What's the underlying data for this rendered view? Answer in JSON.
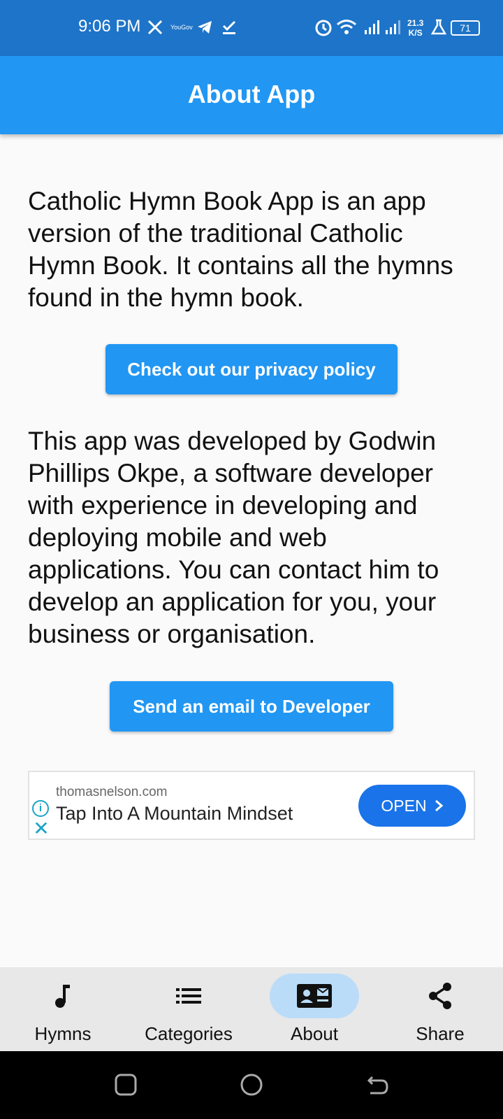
{
  "status_bar": {
    "time": "9:06 PM",
    "network_speed": "21.3",
    "network_unit": "K/S",
    "battery": "71",
    "notification_icons": [
      "x-icon",
      "yougov-icon",
      "telegram-icon",
      "check-icon"
    ],
    "yougov_label": "YouGov"
  },
  "app_bar": {
    "title": "About App"
  },
  "about": {
    "paragraph1": "Catholic Hymn Book App is an app version of the traditional Catholic Hymn Book. It contains all the hymns found in the hymn book.",
    "privacy_button": "Check out our privacy policy",
    "paragraph2": "This app was developed by Godwin Phillips Okpe, a software developer with experience in developing and deploying mobile and web applications. You can contact him to develop an application for you, your business or organisation.",
    "email_button": "Send an email to Developer"
  },
  "ad": {
    "domain": "thomasnelson.com",
    "headline": "Tap Into A Mountain Mindset",
    "cta": "OPEN",
    "info_glyph": "i",
    "close_glyph": "✕"
  },
  "bottom_nav": {
    "items": [
      {
        "label": "Hymns",
        "icon": "music-note-icon",
        "active": false
      },
      {
        "label": "Categories",
        "icon": "list-icon",
        "active": false
      },
      {
        "label": "About",
        "icon": "contact-card-icon",
        "active": true
      },
      {
        "label": "Share",
        "icon": "share-icon",
        "active": false
      }
    ]
  },
  "colors": {
    "status_bar": "#1e74c8",
    "app_bar": "#2196f3",
    "button": "#2196f3",
    "active_nav_pill": "#bbdcf8",
    "ad_cta": "#1a73e8"
  }
}
